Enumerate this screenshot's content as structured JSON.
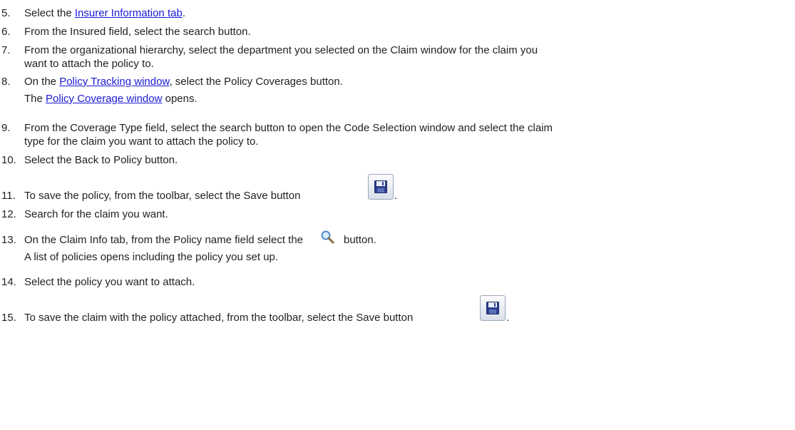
{
  "steps": [
    {
      "num": "5.",
      "parts": [
        "Select the ",
        "Insurer Information tab",
        "."
      ]
    },
    {
      "num": "6.",
      "text": "From the Insured field, select the search button."
    },
    {
      "num": "7.",
      "lines": [
        "From the organizational hierarchy, select the department you selected on the Claim window for the claim you",
        "want to attach the policy to."
      ]
    },
    {
      "num": "8.",
      "parts": [
        "On the ",
        "Policy Tracking window",
        ", select the Policy Coverages button."
      ],
      "note_parts": [
        "The ",
        "Policy Coverage window",
        " opens."
      ]
    },
    {
      "num": "9.",
      "lines": [
        "From the Coverage Type field, select the search button to open the Code Selection window and select the claim",
        "type for the claim you want to attach the policy to."
      ]
    },
    {
      "num": "10.",
      "text": "Select the Back to Policy button."
    },
    {
      "num": "11.",
      "text_before": "To save the policy, from the toolbar, select the Save button",
      "text_after": "."
    },
    {
      "num": "12.",
      "text": "Search for the claim you want."
    },
    {
      "num": "13.",
      "text_before": "On the Claim Info tab, from  the Policy name field select the",
      "text_after": "button.",
      "note": "A list of policies opens including the policy you set up."
    },
    {
      "num": "14.",
      "text": "Select the policy you want to attach."
    },
    {
      "num": "15.",
      "text_before": "To save the claim with the policy attached, from the toolbar, select the Save button",
      "text_after": "."
    }
  ],
  "icons": {
    "save": "floppy-disk-icon",
    "search": "magnifier-icon"
  },
  "colors": {
    "link": "#1a1ad6",
    "text": "#222222"
  }
}
